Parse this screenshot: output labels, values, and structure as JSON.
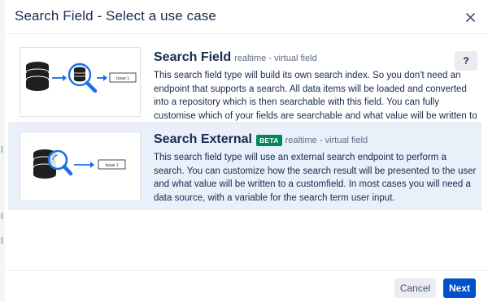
{
  "dialog": {
    "title": "Search Field - Select a use case",
    "close_icon": "close-icon"
  },
  "options": [
    {
      "name": "Search Field",
      "subtitle": "realtime - virtual field",
      "description": "This search field type will build its own search index. So you don't need an endpoint that supports a search. All data items will be loaded and converted into a repository which is then searchable with this field. You can fully customise which of your fields are searchable and what value will be written to a target field.",
      "help_label": "?",
      "thumb_label": "Issue 1",
      "selected": false
    },
    {
      "name": "Search External",
      "badge": "BETA",
      "subtitle": "realtime - virtual field",
      "description": "This search field type will use an external search endpoint to perform a search. You can customize how the search result will be presented to the user and what value will be written to a customfield. In most cases you will need a data source, with a variable for the search term user input.",
      "thumb_label": "Issue 1",
      "selected": true
    }
  ],
  "footer": {
    "cancel_label": "Cancel",
    "next_label": "Next"
  },
  "colors": {
    "primary": "#0052cc",
    "beta_badge": "#00875a",
    "selected_bg": "#e9f0fa",
    "icon_blue": "#1a6ee8",
    "database_dark": "#1f1f1f"
  }
}
